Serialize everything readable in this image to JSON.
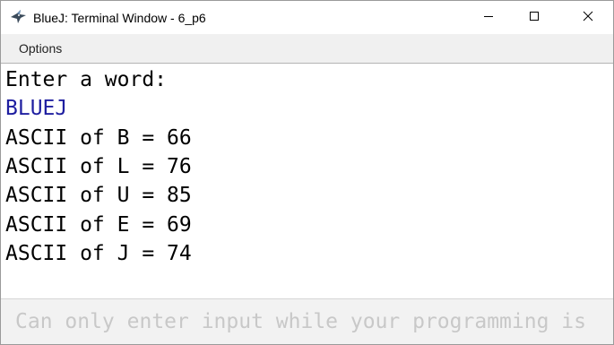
{
  "window": {
    "title": "BlueJ: Terminal Window - 6_p6",
    "app_icon": "bluej-bird-icon"
  },
  "title_buttons": {
    "minimize_icon": "minimize-icon",
    "maximize_icon": "maximize-icon",
    "close_icon": "close-icon"
  },
  "menu": {
    "items": [
      {
        "label": "Options"
      }
    ]
  },
  "terminal": {
    "lines": [
      {
        "text": "Enter a word:",
        "kind": "output"
      },
      {
        "text": "BLUEJ",
        "kind": "input"
      },
      {
        "text": "ASCII of B = 66",
        "kind": "output"
      },
      {
        "text": "ASCII of L = 76",
        "kind": "output"
      },
      {
        "text": "ASCII of U = 85",
        "kind": "output"
      },
      {
        "text": "ASCII of E = 69",
        "kind": "output"
      },
      {
        "text": "ASCII of J = 74",
        "kind": "output"
      }
    ],
    "output_color": "#000000",
    "input_color": "#1e1ea0"
  },
  "input": {
    "value": "",
    "placeholder": "Can only enter input while your programming is"
  }
}
